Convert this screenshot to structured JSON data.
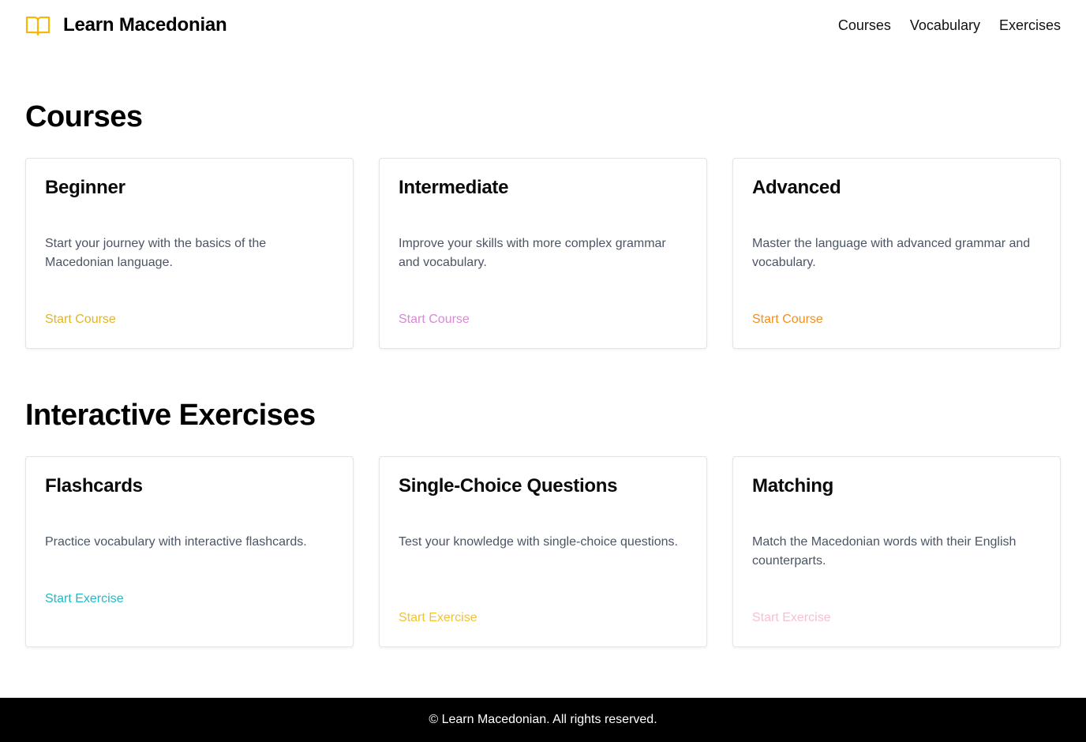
{
  "header": {
    "brand_title": "Learn Macedonian",
    "brand_icon": "book-open-icon",
    "brand_color": "#f5b70a",
    "nav": [
      {
        "label": "Courses"
      },
      {
        "label": "Vocabulary"
      },
      {
        "label": "Exercises"
      }
    ]
  },
  "courses": {
    "title": "Courses",
    "cards": [
      {
        "title": "Beginner",
        "description": "Start your journey with the basics of the Macedonian language.",
        "link": "Start Course",
        "link_color": "#e0b52a"
      },
      {
        "title": "Intermediate",
        "description": "Improve your skills with more complex grammar and vocabulary.",
        "link": "Start Course",
        "link_color": "#d88ad4"
      },
      {
        "title": "Advanced",
        "description": "Master the language with advanced grammar and vocabulary.",
        "link": "Start Course",
        "link_color": "#f0901f"
      }
    ]
  },
  "exercises": {
    "title": "Interactive Exercises",
    "cards": [
      {
        "title": "Flashcards",
        "description": "Practice vocabulary with interactive flashcards.",
        "link": "Start Exercise",
        "link_color": "#22b8c6"
      },
      {
        "title": "Single-Choice Questions",
        "description": "Test your knowledge with single-choice questions.",
        "link": "Start Exercise",
        "link_color": "#f2c230"
      },
      {
        "title": "Matching",
        "description": "Match the Macedonian words with their English counterparts.",
        "link": "Start Exercise",
        "link_color": "#f7bfd2"
      }
    ]
  },
  "footer": {
    "text": "© Learn Macedonian. All rights reserved."
  }
}
